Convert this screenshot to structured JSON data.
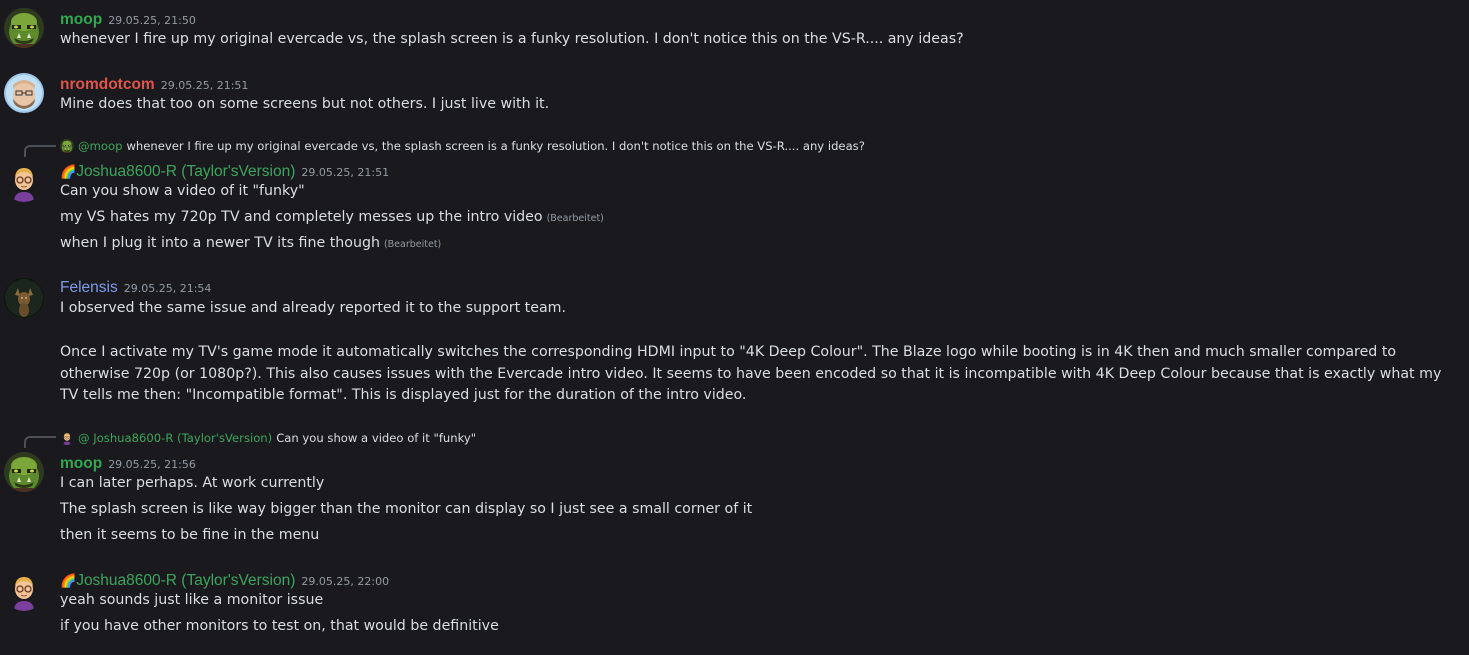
{
  "colors": {
    "background": "#1a1a1e",
    "moop": "#2fa84f",
    "nromdotcom": "#e0544b",
    "joshua": "#3ba55d",
    "felensis": "#7f9aea",
    "text": "#dbdee1",
    "muted": "#949ba4"
  },
  "messages": [
    {
      "author": "moop",
      "timestamp": "29.05.25, 21:50",
      "lines": [
        "whenever I fire up my original evercade vs, the splash screen is a funky resolution. I don't notice this on the VS-R.... any ideas?"
      ]
    },
    {
      "author": "nromdotcom",
      "timestamp": "29.05.25, 21:51",
      "lines": [
        "Mine does that too on some screens but not others. I just live with it."
      ]
    },
    {
      "reply": {
        "mention": "@moop",
        "text": "whenever I fire up my original evercade vs, the splash screen is a funky resolution. I don't notice this on the VS-R.... any ideas?"
      },
      "author": "Joshua8600-R (Taylor'sVersion)",
      "timestamp": "29.05.25, 21:51",
      "lines": [
        "Can you show a video of it \"funky\"",
        "my VS hates my 720p TV and completely messes up the intro video",
        "when I plug it into a newer TV its fine though"
      ],
      "edited_label": "(Bearbeitet)"
    },
    {
      "author": "Felensis",
      "timestamp": "29.05.25, 21:54",
      "lines": [
        "I observed the same issue and already reported it to the support team.",
        "Once I activate my TV's game mode it automatically switches the corresponding HDMI input to \"4K Deep Colour\". The Blaze logo while booting is in 4K then and much smaller compared to otherwise 720p (or 1080p?). This also causes issues with the Evercade intro video. It seems to have been encoded so that it is incompatible with 4K Deep Colour because that is exactly what my TV tells me then: \"Incompatible format\". This is displayed just for the duration of the intro video."
      ]
    },
    {
      "reply": {
        "mention": "@ Joshua8600-R (Taylor'sVersion)",
        "text": "Can you show a video of it \"funky\""
      },
      "author": "moop",
      "timestamp": "29.05.25, 21:56",
      "lines": [
        "I can later perhaps. At work currently",
        "The splash screen is like way bigger than the monitor can display so I just see a small corner of it",
        "then it seems to be fine in the menu"
      ]
    },
    {
      "author": "Joshua8600-R (Taylor'sVersion)",
      "timestamp": "29.05.25, 22:00",
      "lines": [
        "yeah sounds just like a monitor issue",
        "if you have other monitors to test on, that would be definitive"
      ]
    }
  ],
  "icons": {
    "rainbow": "🌈",
    "avatar_moop": "orc-avatar-icon",
    "avatar_nrom": "man-avatar-icon",
    "avatar_joshua": "memoji-avatar-icon",
    "avatar_felensis": "fox-avatar-icon"
  }
}
